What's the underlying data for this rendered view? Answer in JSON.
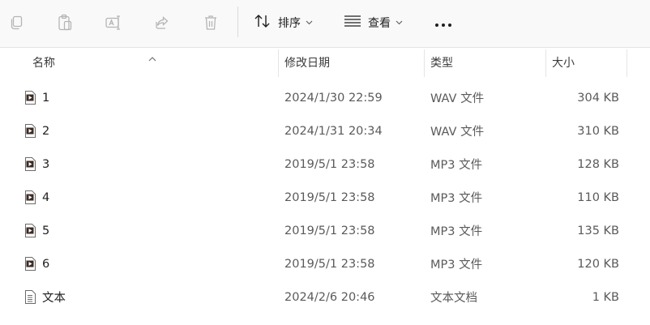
{
  "toolbar": {
    "buttons": [
      {
        "icon": "copy-icon",
        "name": "copy-button"
      },
      {
        "icon": "paste-icon",
        "name": "paste-button"
      },
      {
        "icon": "rename-icon",
        "name": "rename-button"
      },
      {
        "icon": "share-icon",
        "name": "share-button"
      },
      {
        "icon": "delete-icon",
        "name": "delete-button"
      }
    ],
    "sort_label": "排序",
    "view_label": "查看",
    "more_label": "•••"
  },
  "columns": {
    "name": "名称",
    "date": "修改日期",
    "type": "类型",
    "size": "大小"
  },
  "sort_indicator": "ascending",
  "files": [
    {
      "name": "1",
      "date": "2024/1/30 22:59",
      "type": "WAV 文件",
      "size": "304 KB",
      "icon": "audio-file-icon"
    },
    {
      "name": "2",
      "date": "2024/1/31 20:34",
      "type": "WAV 文件",
      "size": "310 KB",
      "icon": "audio-file-icon"
    },
    {
      "name": "3",
      "date": "2019/5/1 23:58",
      "type": "MP3 文件",
      "size": "128 KB",
      "icon": "audio-file-icon"
    },
    {
      "name": "4",
      "date": "2019/5/1 23:58",
      "type": "MP3 文件",
      "size": "110 KB",
      "icon": "audio-file-icon"
    },
    {
      "name": "5",
      "date": "2019/5/1 23:58",
      "type": "MP3 文件",
      "size": "135 KB",
      "icon": "audio-file-icon"
    },
    {
      "name": "6",
      "date": "2019/5/1 23:58",
      "type": "MP3 文件",
      "size": "120 KB",
      "icon": "audio-file-icon"
    },
    {
      "name": "文本",
      "date": "2024/2/6 20:46",
      "type": "文本文档",
      "size": "1 KB",
      "icon": "text-file-icon"
    }
  ],
  "colors": {
    "toolbar_bg": "#f9f9f9",
    "disabled_icon": "#b5b5b5",
    "accent": "#005fb8",
    "text": "#1f1f1f",
    "muted_text": "#5a5a5a"
  }
}
